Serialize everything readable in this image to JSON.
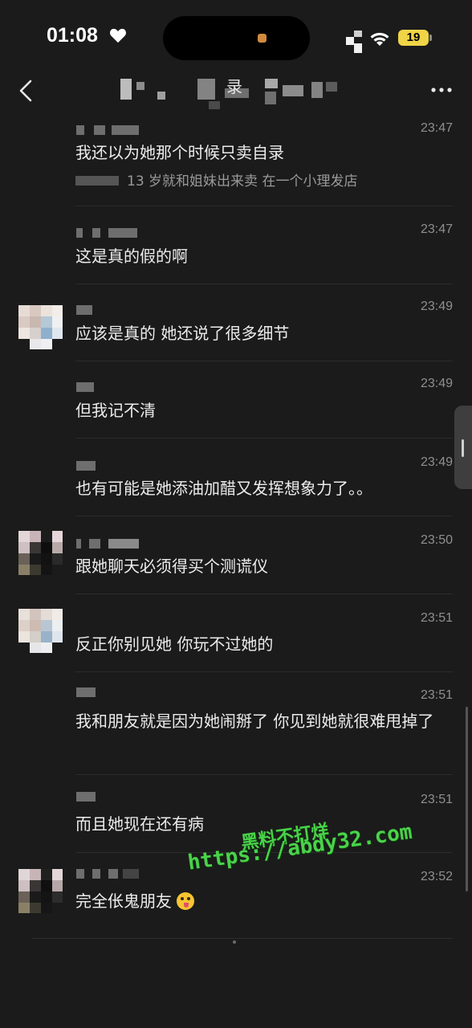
{
  "status_bar": {
    "time": "01:08",
    "battery": "19"
  },
  "nav": {
    "title_visible_tail": "录"
  },
  "messages": [
    {
      "time": "23:47",
      "text": "我还以为她那个时候只卖自录",
      "quote": "13 岁就和姐妹出来卖 在一个小理发店"
    },
    {
      "time": "23:47",
      "text": "这是真的假的啊"
    },
    {
      "time": "23:49",
      "text": "应该是真的 她还说了很多细节"
    },
    {
      "time": "23:49",
      "text": "但我记不清"
    },
    {
      "time": "23:49",
      "text": "也有可能是她添油加醋又发挥想象力了。。"
    },
    {
      "time": "23:50",
      "text": "跟她聊天必须得买个测谎仪"
    },
    {
      "time": "23:51",
      "text": "反正你别见她 你玩不过她的"
    },
    {
      "time": "23:51",
      "text": "我和朋友就是因为她闹掰了 你见到她就很难甩掉了"
    },
    {
      "time": "23:51",
      "text": "而且她现在还有病"
    },
    {
      "time": "23:52",
      "text": "完全伥鬼朋友"
    }
  ],
  "watermark": {
    "line1": "黑料不打烊",
    "line2": "https://abdy32.com"
  },
  "icons": {
    "back": "chevron-left-icon",
    "more": "ellipsis-icon",
    "heart": "heart-icon",
    "wifi": "wifi-icon",
    "emoji": "zany-face-emoji"
  }
}
